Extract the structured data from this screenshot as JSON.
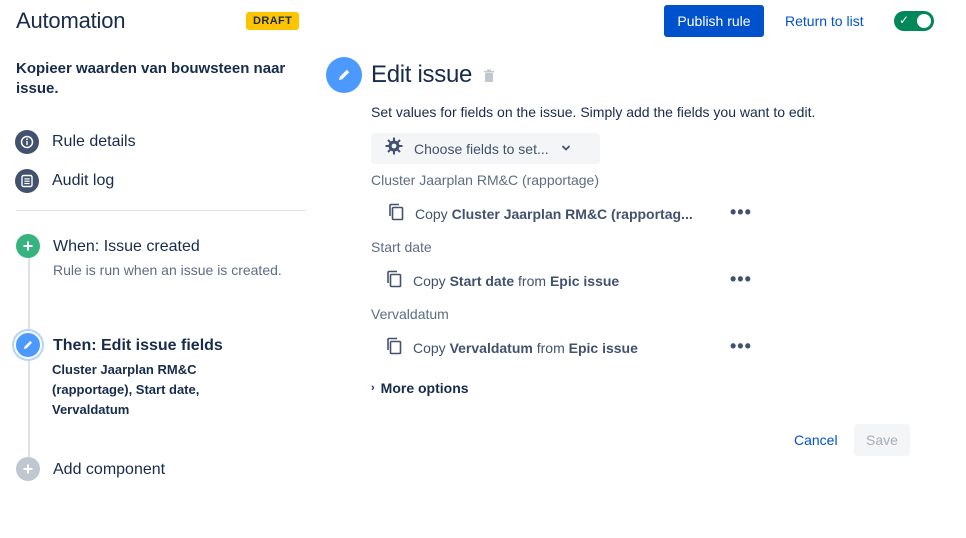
{
  "header": {
    "title": "Automation",
    "badge": "DRAFT",
    "publish_label": "Publish rule",
    "return_label": "Return to list",
    "toggle_check": "✓",
    "enabled": true
  },
  "sidebar": {
    "rule_name": "Kopieer waarden van bouwsteen naar issue.",
    "links": [
      {
        "label": "Rule details",
        "icon": "info-icon"
      },
      {
        "label": "Audit log",
        "icon": "list-icon"
      }
    ],
    "steps": {
      "trigger": {
        "title": "When: Issue created",
        "sub": "Rule is run when an issue is created.",
        "icon": "plus-icon"
      },
      "action": {
        "title": "Then: Edit issue fields",
        "detail_bold": "Cluster Jaarplan RM&C (rapportage)",
        "detail_rest": ", Start date, Vervaldatum",
        "detail_sep": ",",
        "detail_rest_bold": "Start date, Vervaldatum",
        "icon": "pencil-icon"
      },
      "add": {
        "title": "Add component",
        "icon": "plus-icon"
      }
    }
  },
  "main": {
    "title": "Edit issue",
    "description": "Set values for fields on the issue. Simply add the fields you want to edit.",
    "choose_label": "Choose fields to set...",
    "fields": [
      {
        "label": "Cluster Jaarplan RM&C (rapportage)",
        "prefix": "Copy",
        "field": "Cluster Jaarplan RM&C (rapportag...",
        "from": "",
        "source": ""
      },
      {
        "label": "Start date",
        "prefix": "Copy",
        "field": "Start date",
        "from": "from",
        "source": "Epic issue"
      },
      {
        "label": "Vervaldatum",
        "prefix": "Copy",
        "field": "Vervaldatum",
        "from": "from",
        "source": "Epic issue"
      }
    ],
    "dots": "•••",
    "more_options_label": "More options",
    "more_options_chevron": "›",
    "cancel_label": "Cancel",
    "save_label": "Save"
  },
  "colors": {
    "primary": "#0052cc",
    "success": "#00875a",
    "trigger": "#36b37e",
    "action": "#4c9aff",
    "draft": "#ffc400"
  }
}
